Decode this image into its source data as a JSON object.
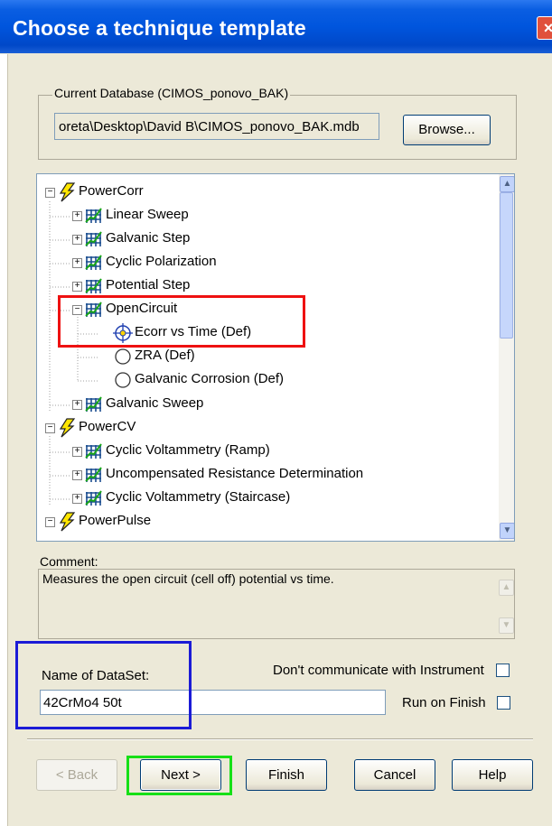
{
  "dialog": {
    "title": "Choose a technique template",
    "close_glyph": "×"
  },
  "database": {
    "legend": "Current Database (CIMOS_ponovo_BAK)",
    "path": "oreta\\Desktop\\David B\\CIMOS_ponovo_BAK.mdb",
    "browse_label": "Browse..."
  },
  "tree": {
    "items": [
      {
        "label": "PowerCorr",
        "icon": "lightning-icon",
        "expander": "−"
      },
      {
        "label": "Linear Sweep",
        "icon": "grid-icon",
        "expander": "+"
      },
      {
        "label": "Galvanic Step",
        "icon": "grid-icon",
        "expander": "+"
      },
      {
        "label": "Cyclic Polarization",
        "icon": "grid-icon",
        "expander": "+"
      },
      {
        "label": "Potential Step",
        "icon": "grid-icon",
        "expander": "+"
      },
      {
        "label": "OpenCircuit",
        "icon": "grid-icon",
        "expander": "−"
      },
      {
        "label": "Ecorr vs Time (Def)",
        "icon": "target-icon",
        "expander": ""
      },
      {
        "label": "ZRA (Def)",
        "icon": "circle-icon",
        "expander": ""
      },
      {
        "label": "Galvanic Corrosion (Def)",
        "icon": "circle-icon",
        "expander": ""
      },
      {
        "label": "Galvanic Sweep",
        "icon": "grid-icon",
        "expander": "+"
      },
      {
        "label": "PowerCV",
        "icon": "lightning-icon",
        "expander": "−"
      },
      {
        "label": "Cyclic Voltammetry (Ramp)",
        "icon": "grid-icon",
        "expander": "+"
      },
      {
        "label": "Uncompensated Resistance Determination",
        "icon": "grid-icon",
        "expander": "+"
      },
      {
        "label": "Cyclic Voltammetry (Staircase)",
        "icon": "grid-icon",
        "expander": "+"
      },
      {
        "label": "PowerPulse",
        "icon": "lightning-icon",
        "expander": "−"
      }
    ],
    "scroll_up": "▲",
    "scroll_down": "▼"
  },
  "comment": {
    "label": "Comment:",
    "text": "Measures the open circuit (cell off) potential vs time."
  },
  "dataset": {
    "label": "Name of DataSet:",
    "value": "42CrMo4 50t",
    "dont_communicate_label": "Don't communicate with Instrument",
    "dont_communicate_checked": false,
    "run_on_finish_label": "Run on Finish",
    "run_on_finish_checked": false
  },
  "buttons": {
    "back": "< Back",
    "next": "Next >",
    "finish": "Finish",
    "cancel": "Cancel",
    "help": "Help"
  },
  "colors": {
    "title_bar": "#0055dd",
    "highlight_red": "#ee1111",
    "highlight_blue": "#1b1bd6",
    "highlight_green": "#16e016"
  }
}
